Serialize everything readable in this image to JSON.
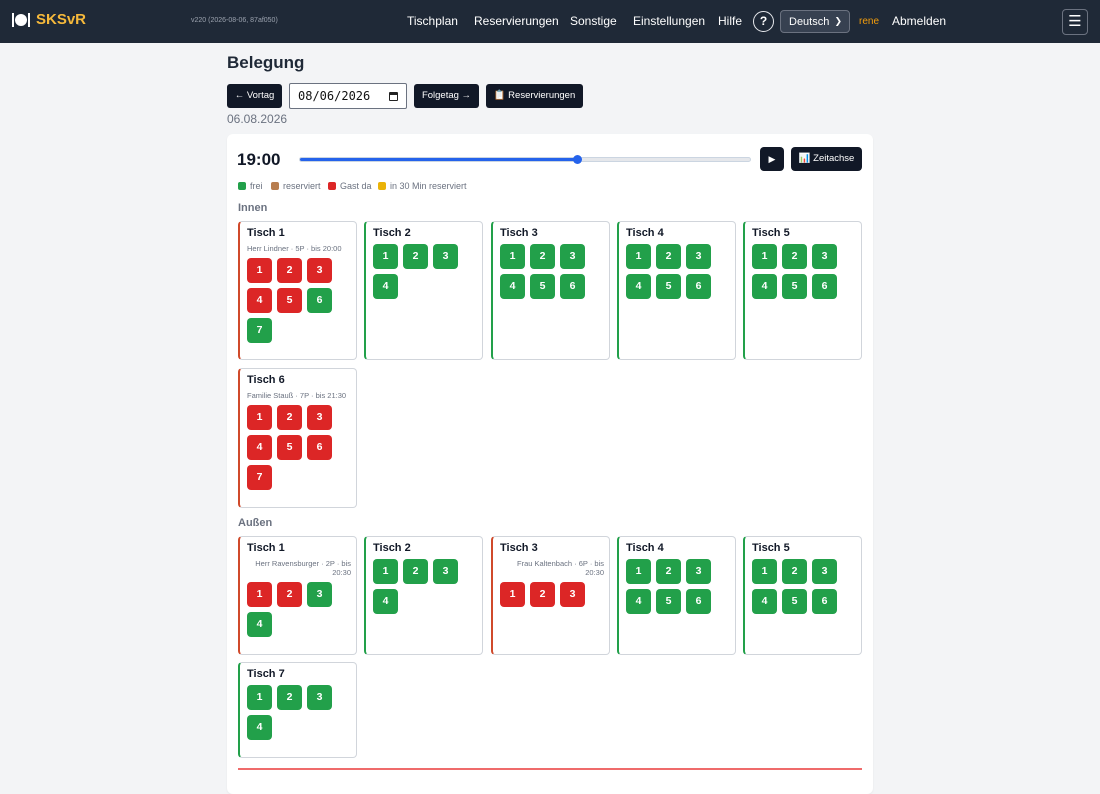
{
  "navbar": {
    "brand": "SKSvR",
    "version": "v220 (2026-08-06, 87af050)",
    "links": [
      "Tischplan",
      "Reservierungen",
      "Sonstige",
      "Einstellungen",
      "Hilfe"
    ],
    "help_icon": "?",
    "language": "Deutsch",
    "user": "rene",
    "logout": "Abmelden",
    "menu_icon": "☰",
    "brand_color": "#f6b93b",
    "user_color": "#f59e0b"
  },
  "header": {
    "title": "Belegung",
    "prev_button": "← Vortag",
    "date_value": "08/06/2026",
    "next_button": "Folgetag →",
    "reservations_button": "📋 Reservierungen",
    "date_subtitle": "06.08.2026"
  },
  "timebar": {
    "time": "19:00",
    "slider_fraction": 0.615,
    "play_label": "▶",
    "timeline_label": "📊 Zeitachse"
  },
  "legend": [
    {
      "label": "frei",
      "color": "#22a04a"
    },
    {
      "label": "reserviert",
      "color": "#b87d4f"
    },
    {
      "label": "Gast da",
      "color": "#dc2626"
    },
    {
      "label": "in 30 Min reserviert",
      "color": "#eab308"
    }
  ],
  "areas": [
    {
      "name": "Innen",
      "tables": [
        {
          "name": "Tisch 1",
          "guest": "Herr Lindner · 5P · bis 20:00",
          "seats": [
            {
              "n": "1",
              "s": "guest"
            },
            {
              "n": "2",
              "s": "guest"
            },
            {
              "n": "3",
              "s": "guest"
            },
            {
              "n": "4",
              "s": "guest"
            },
            {
              "n": "5",
              "s": "guest"
            },
            {
              "n": "6",
              "s": "free"
            },
            {
              "n": "7",
              "s": "free"
            }
          ]
        },
        {
          "name": "Tisch 2",
          "guest": "",
          "seats": [
            {
              "n": "1",
              "s": "free"
            },
            {
              "n": "2",
              "s": "free"
            },
            {
              "n": "3",
              "s": "free"
            },
            {
              "n": "4",
              "s": "free"
            }
          ]
        },
        {
          "name": "Tisch 3",
          "guest": "",
          "seats": [
            {
              "n": "1",
              "s": "free"
            },
            {
              "n": "2",
              "s": "free"
            },
            {
              "n": "3",
              "s": "free"
            },
            {
              "n": "4",
              "s": "free"
            },
            {
              "n": "5",
              "s": "free"
            },
            {
              "n": "6",
              "s": "free"
            }
          ]
        },
        {
          "name": "Tisch 4",
          "guest": "",
          "seats": [
            {
              "n": "1",
              "s": "free"
            },
            {
              "n": "2",
              "s": "free"
            },
            {
              "n": "3",
              "s": "free"
            },
            {
              "n": "4",
              "s": "free"
            },
            {
              "n": "5",
              "s": "free"
            },
            {
              "n": "6",
              "s": "free"
            }
          ]
        },
        {
          "name": "Tisch 5",
          "guest": "",
          "seats": [
            {
              "n": "1",
              "s": "free"
            },
            {
              "n": "2",
              "s": "free"
            },
            {
              "n": "3",
              "s": "free"
            },
            {
              "n": "4",
              "s": "free"
            },
            {
              "n": "5",
              "s": "free"
            },
            {
              "n": "6",
              "s": "free"
            }
          ]
        },
        {
          "name": "Tisch 6",
          "guest": "Familie Stauß · 7P · bis 21:30",
          "seats": [
            {
              "n": "1",
              "s": "guest"
            },
            {
              "n": "2",
              "s": "guest"
            },
            {
              "n": "3",
              "s": "guest"
            },
            {
              "n": "4",
              "s": "guest"
            },
            {
              "n": "5",
              "s": "guest"
            },
            {
              "n": "6",
              "s": "guest"
            },
            {
              "n": "7",
              "s": "guest"
            }
          ]
        }
      ]
    },
    {
      "name": "Außen",
      "tables": [
        {
          "name": "Tisch 1",
          "guest": "Herr Ravensburger · 2P · bis 20:30",
          "seats": [
            {
              "n": "1",
              "s": "guest"
            },
            {
              "n": "2",
              "s": "guest"
            },
            {
              "n": "3",
              "s": "free"
            },
            {
              "n": "4",
              "s": "free"
            }
          ]
        },
        {
          "name": "Tisch 2",
          "guest": "",
          "seats": [
            {
              "n": "1",
              "s": "free"
            },
            {
              "n": "2",
              "s": "free"
            },
            {
              "n": "3",
              "s": "free"
            },
            {
              "n": "4",
              "s": "free"
            }
          ]
        },
        {
          "name": "Tisch 3",
          "guest": "Frau Kaltenbach · 6P · bis 20:30",
          "seats": [
            {
              "n": "1",
              "s": "guest"
            },
            {
              "n": "2",
              "s": "guest"
            },
            {
              "n": "3",
              "s": "guest"
            }
          ]
        },
        {
          "name": "Tisch 4",
          "guest": "",
          "seats": [
            {
              "n": "1",
              "s": "free"
            },
            {
              "n": "2",
              "s": "free"
            },
            {
              "n": "3",
              "s": "free"
            },
            {
              "n": "4",
              "s": "free"
            },
            {
              "n": "5",
              "s": "free"
            },
            {
              "n": "6",
              "s": "free"
            }
          ]
        },
        {
          "name": "Tisch 5",
          "guest": "",
          "seats": [
            {
              "n": "1",
              "s": "free"
            },
            {
              "n": "2",
              "s": "free"
            },
            {
              "n": "3",
              "s": "free"
            },
            {
              "n": "4",
              "s": "free"
            },
            {
              "n": "5",
              "s": "free"
            },
            {
              "n": "6",
              "s": "free"
            }
          ]
        },
        {
          "name": "Tisch 7",
          "guest": "",
          "seats": [
            {
              "n": "1",
              "s": "free"
            },
            {
              "n": "2",
              "s": "free"
            },
            {
              "n": "3",
              "s": "free"
            },
            {
              "n": "4",
              "s": "free"
            }
          ]
        }
      ]
    }
  ]
}
